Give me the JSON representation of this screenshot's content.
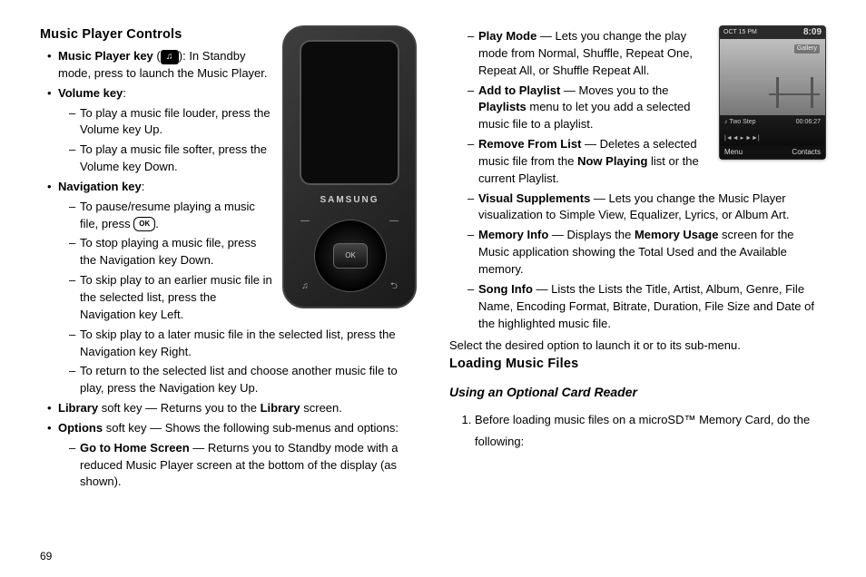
{
  "pageNumber": "69",
  "col1": {
    "heading": "Music Player Controls",
    "musicPlayerKey": {
      "label": "Music Player key",
      "iconName": "music-note-icon",
      "desc": ": In Standby mode, press to launch the Music Player."
    },
    "volumeKey": {
      "label": "Volume key",
      "items": [
        "To play a music file louder, press the Volume key Up.",
        "To play a music file softer, press the Volume key Down."
      ]
    },
    "navigationKey": {
      "label": "Navigation key",
      "pauseResume_pre": "To pause/resume playing a music file, press ",
      "pauseResume_post": ".",
      "okIcon": "OK",
      "items_after": [
        "To stop playing a music file, press the Navigation key Down.",
        "To skip play to an earlier music file in the selected list, press the Navigation key Left.",
        "To skip play to a later music file in the selected list, press the Navigation key Right.",
        "To return to the selected list and choose another music file to play, press the Navigation key Up."
      ]
    },
    "library": {
      "bold": "Library",
      "tail": " soft key — Returns you to the ",
      "bold2": "Library",
      "tail2": " screen."
    },
    "options": {
      "bold": "Options",
      "tail": " soft key — Shows the following sub-menus and options:"
    },
    "goHome": {
      "bold": "Go to Home Screen",
      "tail": " — Returns you to Standby mode with a reduced Music Player screen at the bottom of the display (as shown)."
    },
    "phoneBrand": "SAMSUNG",
    "phoneOk": "OK"
  },
  "col2": {
    "optionsList": [
      {
        "bold": "Play Mode",
        "tail": " — Lets you change the play mode from Normal, Shuffle, Repeat One, Repeat All, or Shuffle Repeat All."
      },
      {
        "bold": "Add to Playlist",
        "tail": " — Moves you to the ",
        "bold2": "Playlists",
        "tail2": " menu to let you add a selected music file to a playlist."
      },
      {
        "bold": "Remove From List",
        "tail": " — Deletes a selected music file from the ",
        "bold2": "Now Playing",
        "tail2": " list or the current Playlist."
      },
      {
        "bold": "Visual Supplements",
        "tail": " — Lets you change the Music Player visualization to Simple View, Equalizer, Lyrics, or Album Art."
      },
      {
        "bold": "Memory Info",
        "tail": " — Displays the ",
        "bold2": "Memory Usage",
        "tail2": " screen for the Music application showing the Total Used and the Available memory."
      },
      {
        "bold": "Song Info",
        "tail": " — Lists the Lists the Title, Artist, Album, Genre, File Name, Encoding Format, Bitrate, Duration, File Size and Date of the highlighted music file."
      }
    ],
    "selectOption": "Select the desired option to launch it or to its sub-menu.",
    "loadingHeading": "Loading Music Files",
    "subHeading": "Using an Optional Card Reader",
    "step1": "Before loading music files on a microSD™ Memory Card, do the following:",
    "miniScreen": {
      "time": "8:09",
      "date": "OCT 15   PM",
      "photoLabel": "Gallery",
      "track": "♪ Two Step",
      "elapsed": "00:06:27",
      "softLeft": "Menu",
      "softRight": "Contacts"
    }
  }
}
